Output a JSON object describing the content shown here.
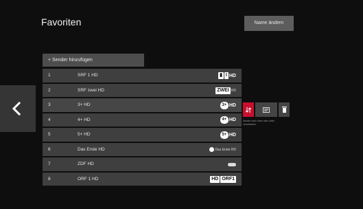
{
  "header": {
    "title": "Favoriten",
    "rename_label": "Name ändern"
  },
  "add_sender": {
    "label": "+ Sender hinzufügen"
  },
  "channels": [
    {
      "num": "1",
      "name": "SRF 1 HD",
      "logo": "srf1-hd-logo"
    },
    {
      "num": "2",
      "name": "SRF zwei HD",
      "logo": "srf-zwei-hd-logo"
    },
    {
      "num": "3",
      "name": "3+ HD",
      "logo": "3plus-hd-logo"
    },
    {
      "num": "4",
      "name": "4+ HD",
      "logo": "4plus-hd-logo"
    },
    {
      "num": "5",
      "name": "5+ HD",
      "logo": "5plus-hd-logo"
    },
    {
      "num": "6",
      "name": "Das Erste HD",
      "logo": "das-erste-hd-logo"
    },
    {
      "num": "7",
      "name": "ZDF HD",
      "logo": "zdf-hd-logo"
    },
    {
      "num": "8",
      "name": "ORF 1 HD",
      "logo": "orf1-hd-logo"
    }
  ],
  "logos": {
    "srf1": {
      "mark": "I",
      "hd": "HD"
    },
    "srfzwei": {
      "mark": "ZWEI",
      "hd": "HD"
    },
    "threeplus": {
      "mark": "3+",
      "hd": "HD"
    },
    "fourplus": {
      "mark": "4+",
      "hd": "HD"
    },
    "fiveplus": {
      "mark": "5+",
      "hd": "HD"
    },
    "daserste": {
      "mark": "Das Erste HD"
    },
    "orf": {
      "prefix": "HD",
      "mark": "ORF1"
    }
  },
  "actions": {
    "move_icon": "move-arrows-icon",
    "sort_icon": "sort-icon",
    "delete_icon": "trash-icon",
    "hint": "Sender nach oben oder unten verschieben"
  },
  "colors": {
    "accent": "#c8102e",
    "row": "#3f3f3f",
    "background": "#0e0e0e"
  }
}
